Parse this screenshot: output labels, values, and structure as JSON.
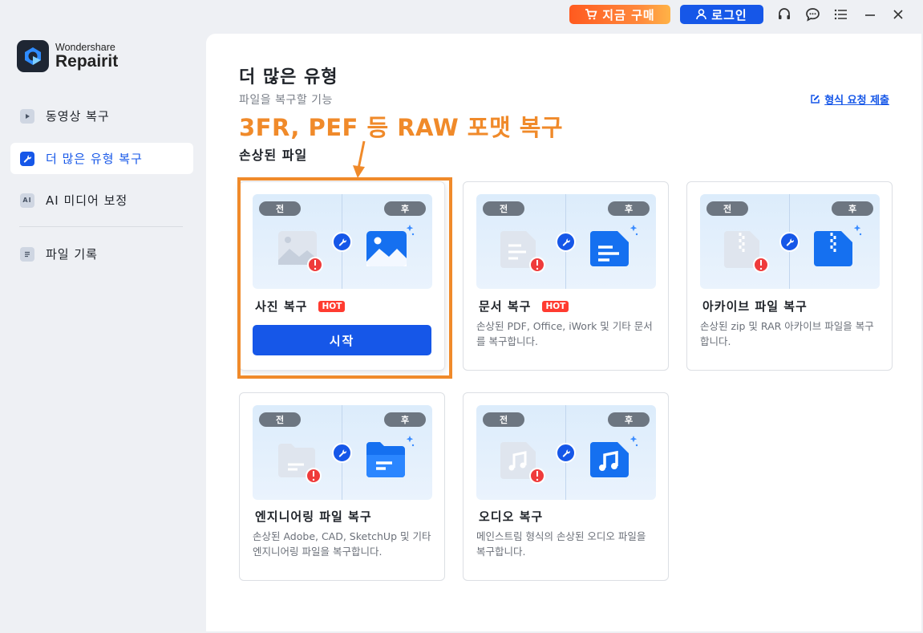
{
  "titlebar": {
    "buy_label": "지금 구매",
    "login_label": "로그인",
    "icons": [
      "headset-icon",
      "chat-icon",
      "menu-icon",
      "minimize-icon",
      "close-icon"
    ]
  },
  "brand": {
    "small": "Wondershare",
    "big": "Repairit"
  },
  "sidebar": {
    "items": [
      {
        "label": "동영상 복구",
        "icon": "play-icon",
        "active": false
      },
      {
        "label": "더 많은 유형 복구",
        "icon": "wrench-icon",
        "active": true
      },
      {
        "label": "AI 미디어 보정",
        "icon": "ai-icon",
        "active": false
      },
      {
        "label": "파일 기록",
        "icon": "file-list-icon",
        "active": false
      }
    ]
  },
  "main": {
    "title": "더 많은 유형",
    "subtitle": "파일을 복구할 기능",
    "request_link": "형식 요청 제출",
    "annotation": "3FR, PEF 등 RAW 포맷 복구",
    "section_title": "손상된 파일",
    "before_label": "전",
    "after_label": "후",
    "hot_label": "HOT",
    "start_label": "시작",
    "cards": [
      {
        "title": "사진 복구",
        "hot": true,
        "desc": "",
        "icon": "photo-icon"
      },
      {
        "title": "문서 복구",
        "hot": true,
        "desc": "손상된 PDF, Office, iWork 및 기타 문서를 복구합니다.",
        "icon": "document-icon"
      },
      {
        "title": "아카이브 파일 복구",
        "hot": false,
        "desc": "손상된 zip 및 RAR 아카이브 파일을 복구합니다.",
        "icon": "archive-icon"
      },
      {
        "title": "엔지니어링 파일 복구",
        "hot": false,
        "desc": "손상된 Adobe, CAD, SketchUp 및 기타 엔지니어링 파일을 복구합니다.",
        "icon": "folder-icon"
      },
      {
        "title": "오디오 복구",
        "hot": false,
        "desc": "메인스트림 형식의 손상된 오디오 파일을 복구합니다.",
        "icon": "music-icon"
      }
    ]
  },
  "colors": {
    "accent": "#1657e8",
    "annotation": "#f08a2a",
    "hot": "#ff3b30",
    "buy_start": "#ff5a1f"
  }
}
